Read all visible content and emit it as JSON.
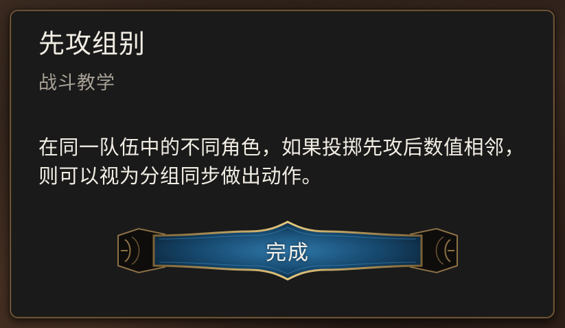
{
  "dialog": {
    "title": "先攻组别",
    "subtitle": "战斗教学",
    "body": "在同一队伍中的不同角色，如果投掷先攻后数值相邻，则可以视为分组同步做出动作。",
    "confirm_label": "完成"
  },
  "colors": {
    "panel_bg": "#1a1a1a",
    "panel_border": "#6e5538",
    "title_text": "#f2ede4",
    "subtitle_text": "#a7a196",
    "button_blue": "#1f5a86",
    "button_gold": "#d6b66e"
  }
}
